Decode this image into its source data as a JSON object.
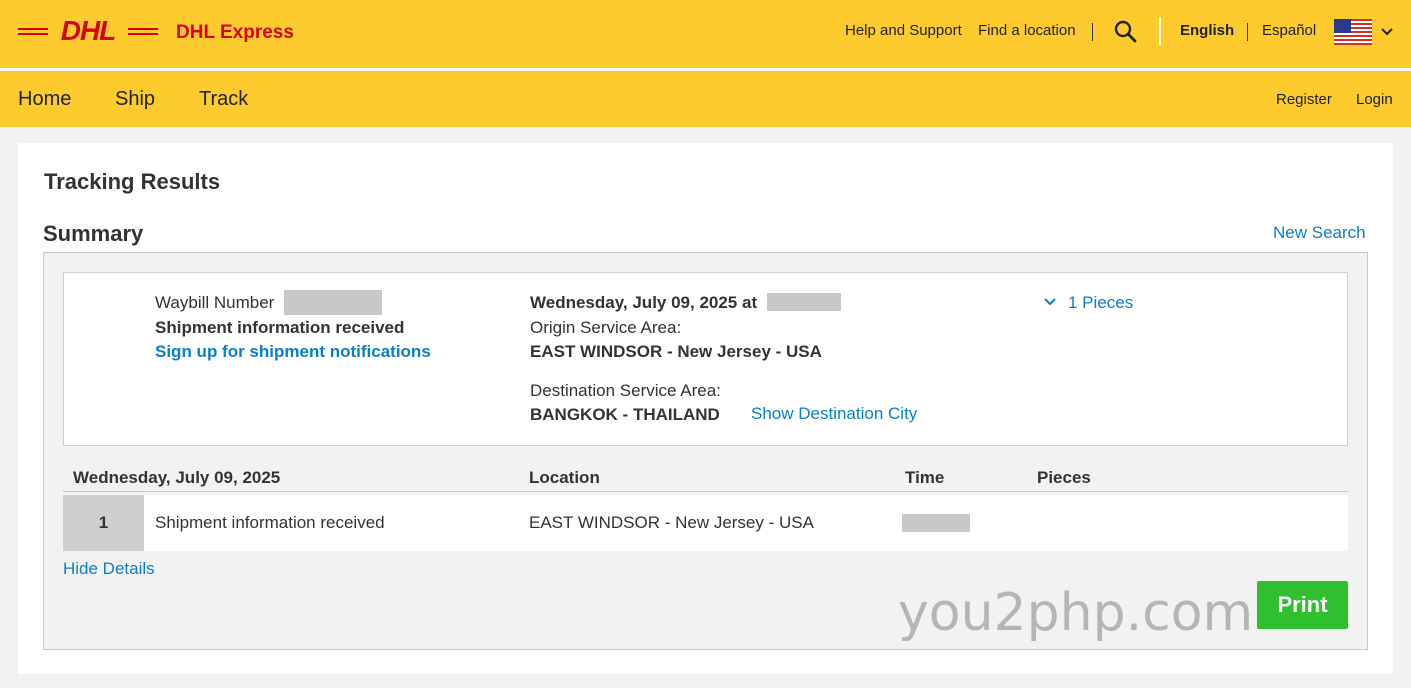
{
  "header": {
    "brand": "DHL Express",
    "links": {
      "help": "Help and Support",
      "find_location": "Find a location"
    },
    "languages": {
      "current": "English",
      "other": "Español"
    }
  },
  "nav": {
    "items": [
      "Home",
      "Ship",
      "Track"
    ],
    "register": "Register",
    "login": "Login"
  },
  "page": {
    "title": "Tracking Results",
    "summary_title": "Summary",
    "new_search": "New Search"
  },
  "shipment": {
    "waybill_label": "Waybill Number",
    "status": "Shipment information received",
    "notify_link": "Sign up for shipment notifications",
    "date_label": "Wednesday, July 09, 2025 at",
    "origin_label": "Origin Service Area:",
    "origin": "EAST WINDSOR - New Jersey - USA",
    "destination_label": "Destination Service Area:",
    "destination": "BANGKOK - THAILAND",
    "show_city": "Show Destination City",
    "pieces": "1 Pieces"
  },
  "table": {
    "headers": [
      "Wednesday, July 09, 2025",
      "Location",
      "Time",
      "Pieces"
    ],
    "rows": [
      {
        "num": "1",
        "event": "Shipment information received",
        "location": "EAST WINDSOR - New Jersey - USA"
      }
    ]
  },
  "hide_details": "Hide Details",
  "watermark": "you2php.com",
  "print_label": "Print",
  "colors": {
    "dhl_yellow": "#fecb2f",
    "dhl_red": "#d40511",
    "link_blue": "#0a7fc8",
    "print_green": "#2fbf2f"
  },
  "icons": [
    "dhl-logo-icon",
    "search-icon",
    "us-flag-icon",
    "chevron-down-icon"
  ]
}
